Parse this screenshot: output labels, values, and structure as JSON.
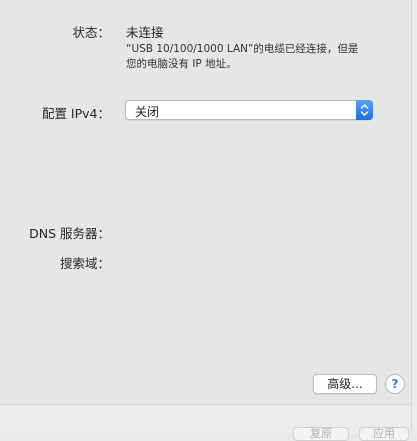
{
  "status": {
    "label": "状态：",
    "value": "未连接",
    "description_line1": "“USB 10/100/1000 LAN”的电缆已经连接，但是",
    "description_line2": "您的电脑没有 IP 地址。"
  },
  "ipv4": {
    "label": "配置 IPv4：",
    "selected": "关闭"
  },
  "dns": {
    "label": "DNS 服务器："
  },
  "search_domains": {
    "label": "搜索域："
  },
  "advanced_button": "高级...",
  "help_button": "?",
  "footer": {
    "revert_label": "复原",
    "apply_label": "应用"
  }
}
